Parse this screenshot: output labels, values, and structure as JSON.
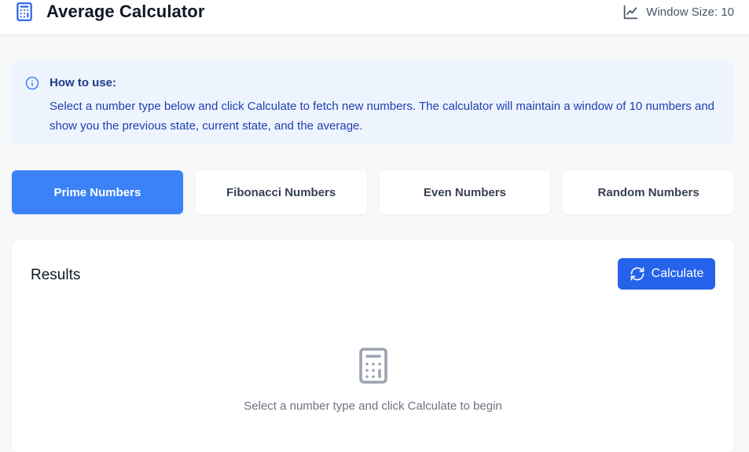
{
  "header": {
    "title": "Average Calculator",
    "logo_icon": "calculator-icon",
    "window_icon": "line-chart-icon",
    "window_size_label": "Window Size: 10"
  },
  "info": {
    "icon": "info-circle-icon",
    "title": "How to use:",
    "text": "Select a number type below and click Calculate to fetch new numbers. The calculator will maintain a window of 10 numbers and show you the previous state, current state, and the average."
  },
  "tabs": [
    {
      "label": "Prime Numbers",
      "active": true
    },
    {
      "label": "Fibonacci Numbers",
      "active": false
    },
    {
      "label": "Even Numbers",
      "active": false
    },
    {
      "label": "Random Numbers",
      "active": false
    }
  ],
  "results": {
    "title": "Results",
    "calculate_label": "Calculate",
    "calculate_icon": "refresh-icon",
    "empty_icon": "calculator-icon",
    "empty_text": "Select a number type and click Calculate to begin"
  },
  "colors": {
    "accent": "#3b82f6",
    "button": "#2563eb",
    "info_bg": "#eef4fe",
    "info_text": "#1e40af",
    "page_bg": "#f7f8fa"
  }
}
